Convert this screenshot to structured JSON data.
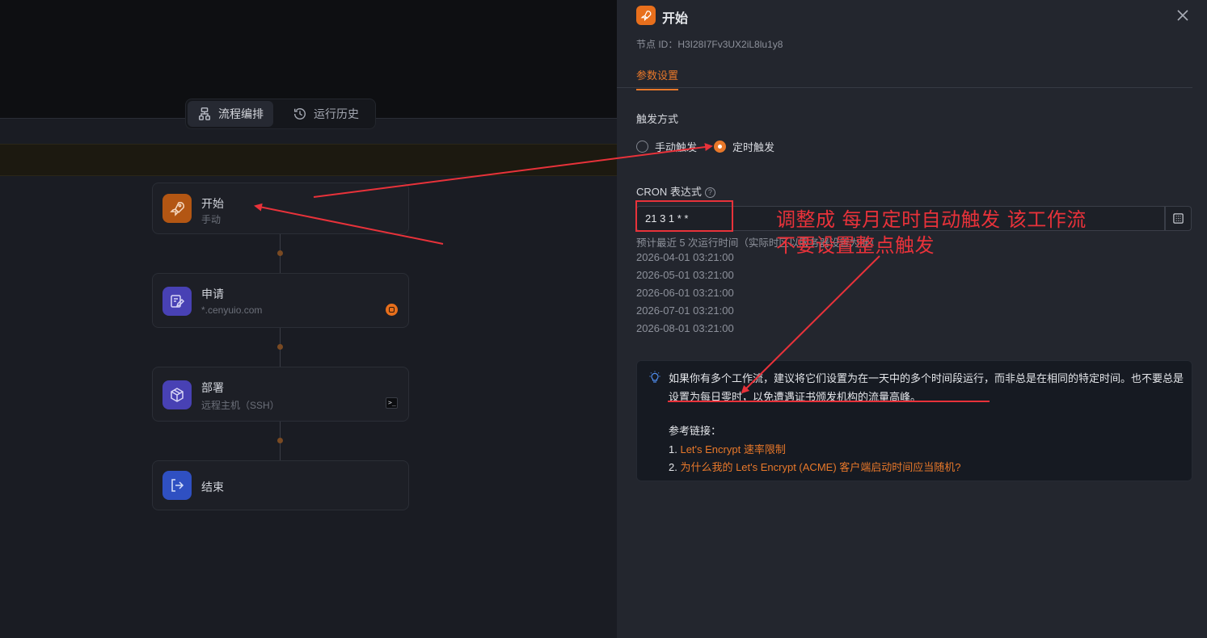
{
  "canvas": {
    "tabs": [
      {
        "label": "流程编排",
        "icon": "flow-icon",
        "active": true
      },
      {
        "label": "运行历史",
        "icon": "history-icon",
        "active": false
      }
    ],
    "nodes": [
      {
        "title": "开始",
        "subtitle": "手动",
        "icon": "rocket-icon",
        "color": "#e86f1c"
      },
      {
        "title": "申请",
        "subtitle": "*.cenyuio.com",
        "icon": "certificate-apply-icon",
        "color": "#5b50d6"
      },
      {
        "title": "部署",
        "subtitle": "远程主机（SSH）",
        "icon": "package-icon",
        "color": "#5b50d6"
      },
      {
        "title": "结束",
        "subtitle": "",
        "icon": "exit-icon",
        "color": "#3b5fd9"
      }
    ]
  },
  "panel": {
    "title": "开始",
    "node_id": "节点 ID：H3I28I7Fv3UX2iL8lu1y8",
    "tab": "参数设置",
    "trigger_label": "触发方式",
    "trigger_options": [
      {
        "label": "手动触发",
        "checked": false
      },
      {
        "label": "定时触发",
        "checked": true
      }
    ],
    "cron_label": "CRON 表达式",
    "cron_value": "21 3 1 * *",
    "hint": "预计最近 5 次运行时间（实际时区以服务器设置为准）",
    "run_times": [
      "2026-04-01 03:21:00",
      "2026-05-01 03:21:00",
      "2026-06-01 03:21:00",
      "2026-07-01 03:21:00",
      "2026-08-01 03:21:00"
    ],
    "tip": {
      "text": "如果你有多个工作流，建议将它们设置为在一天中的多个时间段运行，而非总是在相同的特定时间。也不要总是设置为每日零时，以免遭遇证书颁发机构的流量高峰。",
      "ref_title": "参考链接：",
      "refs": [
        {
          "num": "1.",
          "label": "Let's Encrypt 速率限制"
        },
        {
          "num": "2.",
          "label": "为什么我的 Let's Encrypt (ACME) 客户端启动时间应当随机?"
        }
      ]
    }
  },
  "annotation": {
    "line1": "调整成 每月定时自动触发 该工作流",
    "line2": "不要设置整点触发",
    "color": "#e8323a"
  },
  "colors": {
    "accent": "#e8782a",
    "panel_bg": "#23262e",
    "canvas_bg": "#1a1c23"
  }
}
